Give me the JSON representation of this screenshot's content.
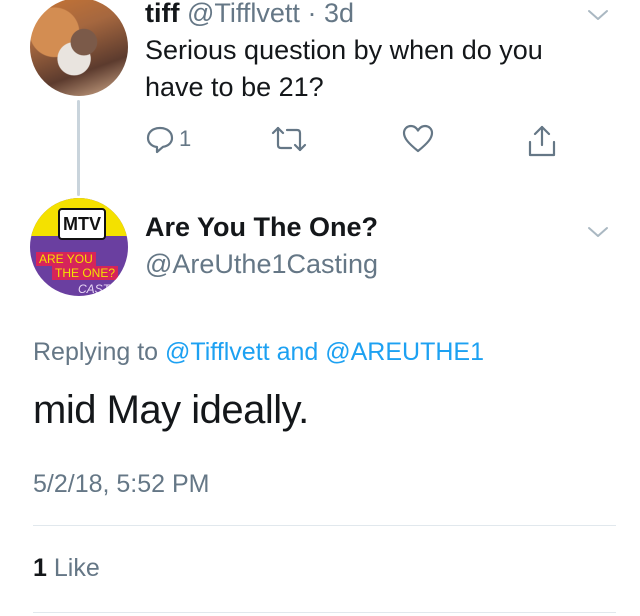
{
  "parent_tweet": {
    "display_name": "tiff",
    "handle": "@Tifflvett",
    "separator": "·",
    "time": "3d",
    "text": "Serious question by when do you have to be 21?",
    "reply_count": "1"
  },
  "main_tweet": {
    "display_name": "Are You The One?",
    "handle": "@AreUthe1Casting",
    "avatar_text": {
      "logo": "MTV",
      "line1": "ARE YOU",
      "line2": "THE ONE?",
      "line3": "CASTI"
    },
    "replying_prefix": "Replying to",
    "replying_mention_1": "@Tifflvett",
    "replying_and": "and",
    "replying_mention_2": "@AREUTHE1",
    "text": "mid May ideally.",
    "timestamp": "5/2/18, 5:52 PM",
    "like_count": "1",
    "like_label": "Like"
  },
  "icons": {
    "reply": "reply-icon",
    "retweet": "retweet-icon",
    "like": "heart-icon",
    "share": "share-icon",
    "menu": "chevron-down-icon"
  },
  "colors": {
    "text": "#14171a",
    "secondary": "#657786",
    "link": "#1da1f2",
    "divider": "#e1e8ed",
    "thread_line": "#c9d4dc"
  }
}
